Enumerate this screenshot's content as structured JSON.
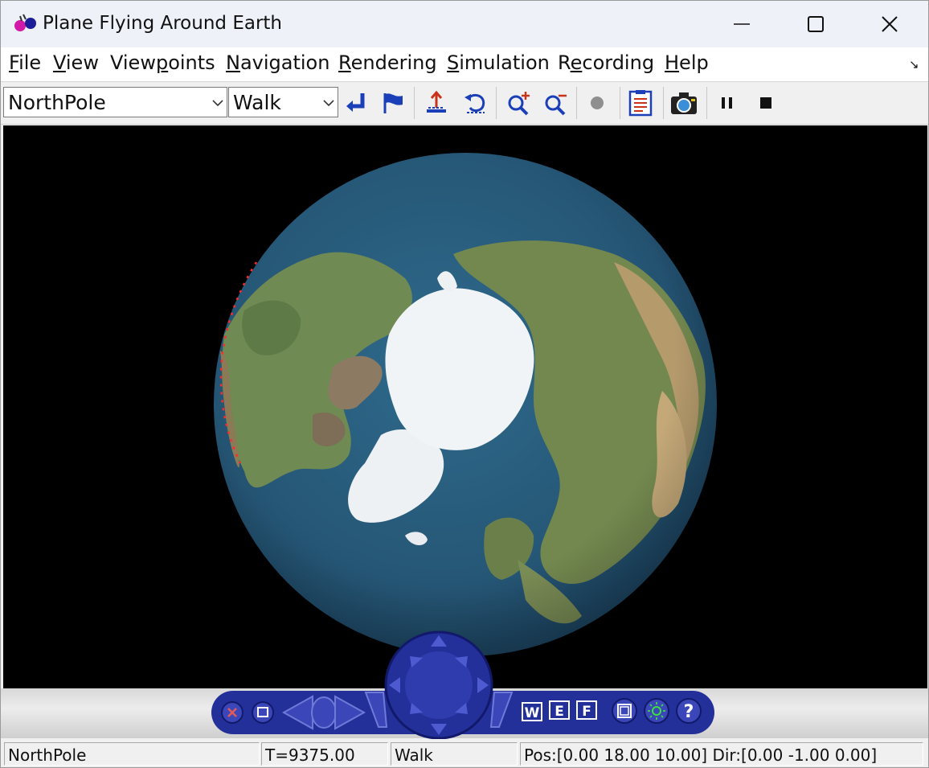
{
  "window": {
    "title": "Plane Flying Around Earth"
  },
  "menu": [
    {
      "label": "File",
      "underline": "F",
      "rest": "ile"
    },
    {
      "label": "View",
      "underline": "V",
      "rest": "iew"
    },
    {
      "label": "Viewpoints",
      "pre": "View",
      "underline": "p",
      "rest": "oints"
    },
    {
      "label": "Navigation",
      "underline": "N",
      "rest": "avigation"
    },
    {
      "label": "Rendering",
      "underline": "R",
      "rest": "endering"
    },
    {
      "label": "Simulation",
      "underline": "S",
      "rest": "imulation"
    },
    {
      "label": "Recording",
      "pre": "R",
      "underline": "e",
      "rest": "cording"
    },
    {
      "label": "Help",
      "underline": "H",
      "rest": "elp"
    }
  ],
  "toolbar": {
    "viewpoint_value": "NorthPole",
    "navigation_value": "Walk",
    "icons": [
      "go-to-viewpoint-icon",
      "flag-icon",
      "straighten-icon",
      "undo-move-icon",
      "zoom-in-icon",
      "zoom-out-icon",
      "record-icon",
      "console-icon",
      "snapshot-icon",
      "pause-icon",
      "stop-icon"
    ]
  },
  "nav_panel": {
    "buttons": [
      "close-icon",
      "minimize-icon",
      "rotate-left-icon",
      "rotate-right-icon",
      "walk",
      "examine",
      "fly",
      "fit-view-icon",
      "headlight-icon",
      "help-icon"
    ],
    "mode_labels": [
      "W",
      "E",
      "F"
    ],
    "help_label": "?"
  },
  "status": {
    "viewpoint": "NorthPole",
    "time": "T=9375.00",
    "mode": "Walk",
    "pos_dir": "Pos:[0.00 18.00 10.00] Dir:[0.00 -1.00 0.00]"
  },
  "colors": {
    "nav_panel": "#23309a",
    "toolbar_icon_blue": "#1a3fb8",
    "ocean": "#2b5d80",
    "ice": "#f1f4f7"
  }
}
